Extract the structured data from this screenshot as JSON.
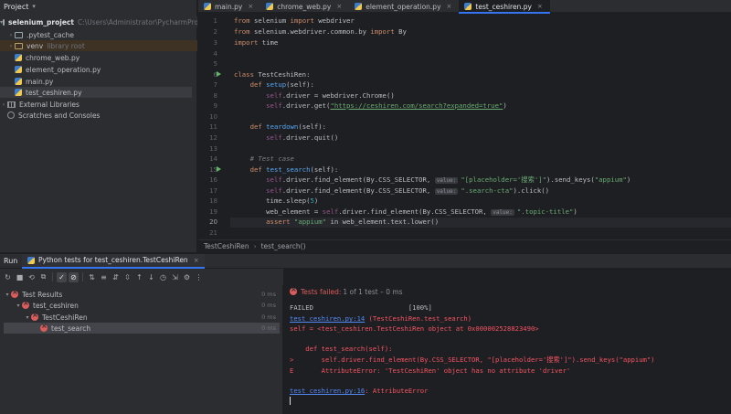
{
  "project": {
    "title": "Project",
    "root_name": "selenium_project",
    "root_path": "C:\\Users\\Administrator\\PycharmProjects\\s",
    "items": [
      {
        "label": "pytest_cache",
        "extra": ""
      },
      {
        "label": "venv",
        "extra": "library root"
      },
      {
        "label": "chrome_web.py",
        "extra": ""
      },
      {
        "label": "element_operation.py",
        "extra": ""
      },
      {
        "label": "main.py",
        "extra": ""
      },
      {
        "label": "test_ceshiren.py",
        "extra": ""
      }
    ],
    "external": "External Libraries",
    "scratches": "Scratches and Consoles"
  },
  "tabs": [
    "main.py",
    "chrome_web.py",
    "element_operation.py",
    "test_ceshiren.py"
  ],
  "code": {
    "line_numbers": [
      "1",
      "2",
      "3",
      "4",
      "5",
      "6",
      "7",
      "8",
      "9",
      "10",
      "11",
      "12",
      "13",
      "14",
      "15",
      "16",
      "17",
      "18",
      "19",
      "20",
      "21"
    ],
    "l1_kw": "from",
    "l1_mod": " selenium ",
    "l1_kw2": "import",
    "l1_name": " webdriver",
    "l2_kw": "from",
    "l2_mod": " selenium.webdriver.common.by ",
    "l2_kw2": "import",
    "l2_name": " By",
    "l3_kw": "import",
    "l3_name": " time",
    "l6_kw": "class",
    "l6_name": " TestCeshiRen:",
    "l7_kw": "def",
    "l7_fn": "setup",
    "l7_rest": "(self):",
    "l8_a": "self",
    "l8_b": ".driver = webdriver.Chrome()",
    "l9_a": "self",
    "l9_b": ".driver.get(",
    "l9_str": "\"https://ceshiren.com/search?expanded=true\"",
    "l9_c": ")",
    "l11_kw": "def",
    "l11_fn": "teardown",
    "l11_rest": "(self):",
    "l12_a": "self",
    "l12_b": ".driver.quit()",
    "l14_cm": "# Test case",
    "l15_kw": "def",
    "l15_fn": "test_search",
    "l15_rest": "(self):",
    "l16_a": "self",
    "l16_b": ".driver.find_element(By.CSS_SELECTOR, ",
    "l16_hint": "value:",
    "l16_str": "\"[placeholder='搜索']\"",
    "l16_c": ").send_keys(",
    "l16_str2": "\"appium\"",
    "l16_d": ")",
    "l17_a": "self",
    "l17_b": ".driver.find_element(By.CSS_SELECTOR, ",
    "l17_hint": "value:",
    "l17_str": "\".search-cta\"",
    "l17_c": ").click()",
    "l18_a": "time.sleep(",
    "l18_num": "5",
    "l18_b": ")",
    "l19_a": "web_element = ",
    "l19_self": "self",
    "l19_b": ".driver.find_element(By.CSS_SELECTOR, ",
    "l19_hint": "value:",
    "l19_str": "\".topic-title\"",
    "l19_c": ")",
    "l20_kw": "assert ",
    "l20_str": "\"appium\"",
    "l20_b": " in web_element.text.lower()"
  },
  "breadcrumbs": [
    "TestCeshiRen",
    "test_search()"
  ],
  "run": {
    "title": "Run",
    "tab_label": "Python tests for test_ceshiren.TestCeshiRen",
    "tree": [
      {
        "label": "Test Results",
        "time": "0 ms"
      },
      {
        "label": "test_ceshiren",
        "time": "0 ms"
      },
      {
        "label": "TestCeshiRen",
        "time": "0 ms"
      },
      {
        "label": "test_search",
        "time": "0 ms"
      }
    ],
    "status_fail": "Tests failed:",
    "status_rest": "1 of 1 test – 0 ms",
    "console": {
      "failed": "FAILED                        [100%]",
      "link1": "test_ceshiren.py:14",
      "link1_rest": " (TestCeshiRen.test_search)",
      "self_line": "self = <test_ceshiren.TestCeshiRen object at 0x000002528823490>",
      "def_line": "    def test_search(self):",
      "arrow_line": ">       self.driver.find_element(By.CSS_SELECTOR, \"[placeholder='搜索']\").send_keys(\"appium\")",
      "error_line": "E       AttributeError: 'TestCeshiRen' object has no attribute 'driver'",
      "link2": "test_ceshiren.py:16",
      "link2_rest": ": AttributeError"
    }
  }
}
